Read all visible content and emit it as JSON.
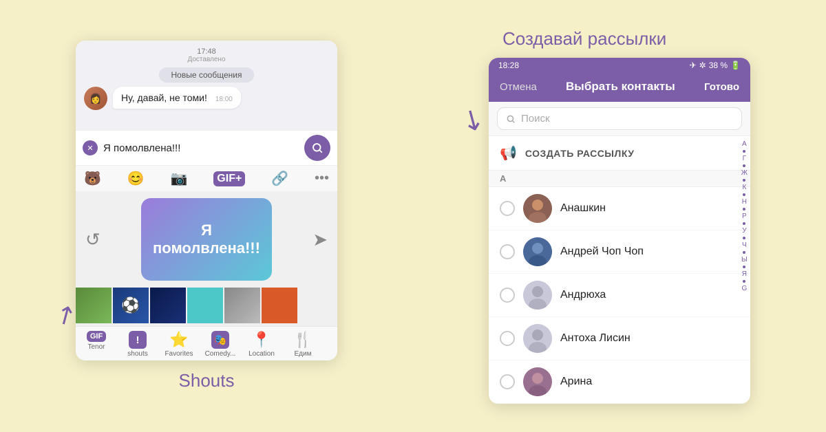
{
  "left": {
    "caption": "Shouts",
    "time_top": "17:48",
    "delivered": "Доставлено",
    "new_messages_pill": "Новые сообщения",
    "incoming_msg": "Ну, давай, не томи!",
    "incoming_time": "18:00",
    "typed_text": "Я помолвлена!!!",
    "sticker_text": "Я помолвлена!!!",
    "tabs": [
      {
        "label": "Tenor",
        "icon": "gif"
      },
      {
        "label": "shouts",
        "icon": "shout"
      },
      {
        "label": "Favorites",
        "icon": "⭐"
      },
      {
        "label": "Comedy...",
        "icon": "comedy"
      },
      {
        "label": "Location",
        "icon": "📍"
      },
      {
        "label": "Едим",
        "icon": "🍴"
      }
    ]
  },
  "right": {
    "caption": "Создавай рассылки",
    "status_time": "18:28",
    "battery": "38 %",
    "nav_cancel": "Отмена",
    "nav_title": "Выбрать контакты",
    "nav_done": "Готово",
    "search_placeholder": "Поиск",
    "broadcast_label": "СОЗДАТЬ РАССЫЛКУ",
    "section_a": "А",
    "contacts": [
      {
        "name": "Анашкин",
        "avatar_type": "photo1"
      },
      {
        "name": "Андрей Чоп Чоп",
        "avatar_type": "photo2"
      },
      {
        "name": "Андрюха",
        "avatar_type": "default"
      },
      {
        "name": "Антоха Лисин",
        "avatar_type": "default"
      },
      {
        "name": "Арина",
        "avatar_type": "photo3"
      }
    ],
    "alpha_letters": [
      "А",
      "Г",
      "Ж",
      "К",
      "Н",
      "Р",
      "У",
      "Ч",
      "Ы",
      "Я",
      "G"
    ]
  }
}
